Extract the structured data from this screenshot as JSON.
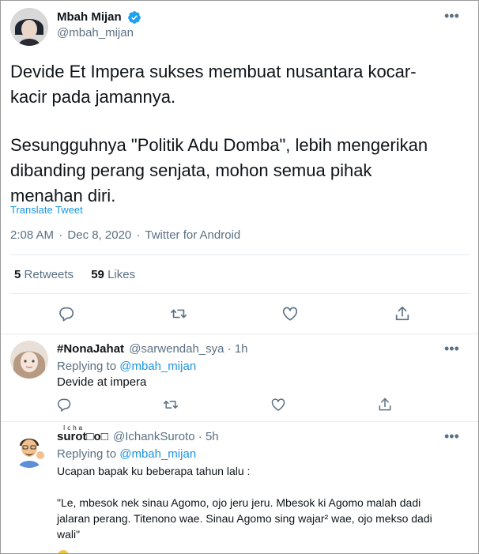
{
  "main_tweet": {
    "author_name": "Mbah Mijan",
    "author_handle": "@mbah_mijan",
    "text_line1": "Devide Et Impera sukses membuat nusantara kocar-",
    "text_line2": "kacir pada jamannya.",
    "text_line3": "Sesungguhnya \"Politik Adu Domba\", lebih mengerikan",
    "text_line4": "dibanding perang senjata, mohon semua pihak",
    "text_line5": "menahan diri.",
    "translate_label": "Translate Tweet",
    "time": "2:08 AM",
    "date": "Dec 8, 2020",
    "source": "Twitter for Android",
    "separator": "·",
    "retweets_count": "5",
    "retweets_label": "Retweets",
    "likes_count": "59",
    "likes_label": "Likes"
  },
  "replies": [
    {
      "author_name": "#NonaJahat",
      "author_handle": "@sarwendah_sya",
      "time": "1h",
      "replying_prefix": "Replying to",
      "replying_to": "@mbah_mijan",
      "text": "Devide at impera"
    },
    {
      "author_name_superscript": "Icha",
      "author_name": "surot□o□",
      "author_handle": "@IchankSuroto",
      "time": "5h",
      "replying_prefix": "Replying to",
      "replying_to": "@mbah_mijan",
      "text_line1": "Ucapan bapak ku beberapa tahun lalu :",
      "text_line2": "\"Le, mbesok nek sinau Agomo, ojo jeru jeru. Mbesok ki Agomo malah dadi",
      "text_line3": "jalaran perang. Titenono wae. Sinau Agomo sing wajar² wae, ojo mekso dadi",
      "text_line4": "wali\""
    }
  ],
  "colors": {
    "accent": "#1b95e0",
    "muted": "#5b7083",
    "text": "#0f1419",
    "divider": "#e6ecf0",
    "verified": "#1da1f2"
  },
  "icons": [
    "verified-badge-icon",
    "more-icon",
    "reply-icon",
    "retweet-icon",
    "like-icon",
    "share-icon"
  ]
}
